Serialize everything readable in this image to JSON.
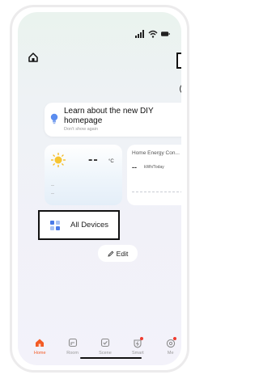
{
  "header": {
    "home_icon": "home-icon",
    "add_icon": "plus-icon",
    "more_icon": "more-dots-icon"
  },
  "banner": {
    "title": "Learn about the new DIY homepage",
    "subtitle": "Don't show again",
    "icon": "lightbulb-icon"
  },
  "weather": {
    "temperature": "--",
    "unit": "°C",
    "line1": "--",
    "line2": "--",
    "icon": "sun-cloud-icon"
  },
  "energy": {
    "title": "Home Energy Con...",
    "value": "--",
    "unit": "kWh/Today"
  },
  "devices": {
    "label": "All Devices",
    "icon": "grid-icon"
  },
  "edit": {
    "label": "Edit",
    "icon": "pencil-icon"
  },
  "tabs": [
    {
      "label": "Home",
      "icon": "home-filled-icon",
      "active": true
    },
    {
      "label": "Room",
      "icon": "room-icon",
      "active": false
    },
    {
      "label": "Scene",
      "icon": "scene-icon",
      "active": false
    },
    {
      "label": "Smart",
      "icon": "smart-icon",
      "active": false
    },
    {
      "label": "Me",
      "icon": "me-icon",
      "active": false
    }
  ],
  "colors": {
    "accent": "#f35b25",
    "notification": "#ef3b2f"
  }
}
